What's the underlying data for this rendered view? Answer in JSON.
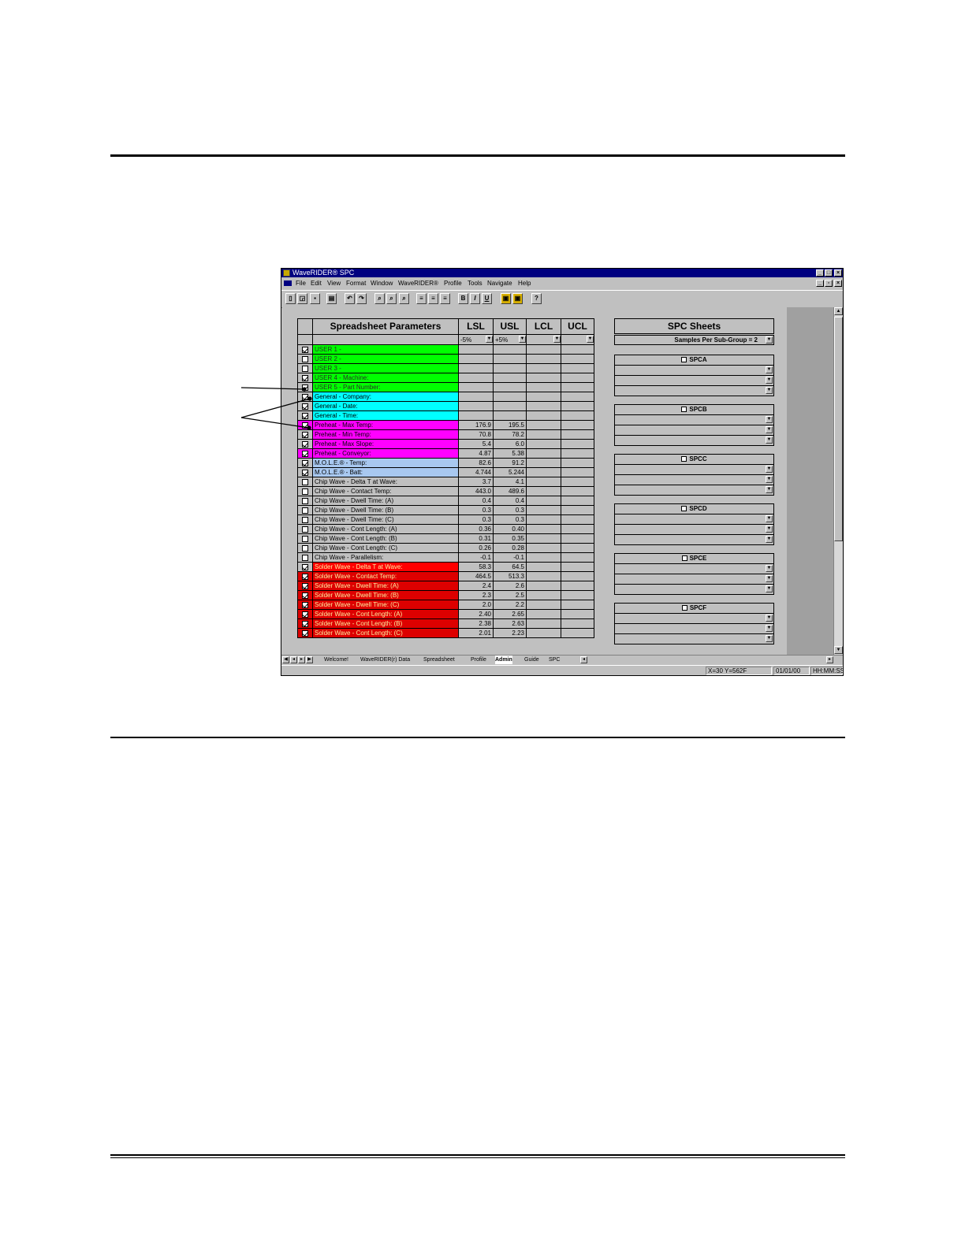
{
  "window": {
    "title": "WaveRIDER® SPC",
    "menu": [
      "File",
      "Edit",
      "View",
      "Format",
      "Window",
      "WaveRIDER®",
      "Profile",
      "Tools",
      "Navigate",
      "Help"
    ]
  },
  "sheet": {
    "header": {
      "params": "Spreadsheet Parameters",
      "lsl": "LSL",
      "usl": "USL",
      "lcl": "LCL",
      "ucl": "UCL"
    },
    "subheader": {
      "lsl": "-5%",
      "usl": "+5%"
    },
    "colors": {
      "green": "#00ff00",
      "cyan": "#00ffff",
      "magenta": "#ff00ff",
      "lightblue": "#a8c8f0",
      "gray": "#c0c0c0",
      "red": "#ff0000",
      "darkred": "#dd0000"
    },
    "rows": [
      {
        "label": "USER 1 -",
        "checked": true,
        "color": "#00ff00",
        "lsl": "",
        "usl": ""
      },
      {
        "label": "USER 2 -",
        "checked": false,
        "color": "#00ff00",
        "lsl": "",
        "usl": ""
      },
      {
        "label": "USER 3 -",
        "checked": false,
        "color": "#00ff00",
        "lsl": "",
        "usl": ""
      },
      {
        "label": "USER 4 - Machine:",
        "checked": true,
        "color": "#00ff00",
        "lsl": "",
        "usl": ""
      },
      {
        "label": "USER 5 - Part Number:",
        "checked": true,
        "color": "#00ff00",
        "lsl": "",
        "usl": ""
      },
      {
        "label": "General - Company:",
        "checked": true,
        "color": "#00ffff",
        "lsl": "",
        "usl": ""
      },
      {
        "label": "General - Date:",
        "checked": true,
        "color": "#00ffff",
        "lsl": "",
        "usl": ""
      },
      {
        "label": "General - Time:",
        "checked": true,
        "color": "#00ffff",
        "lsl": "",
        "usl": ""
      },
      {
        "label": "Preheat - Max Temp:",
        "checked": true,
        "color": "#ff00ff",
        "lsl": "176.9",
        "usl": "195.5"
      },
      {
        "label": "Preheat - Min Temp:",
        "checked": true,
        "color": "#ff00ff",
        "lsl": "70.8",
        "usl": "78.2"
      },
      {
        "label": "Preheat - Max Slope:",
        "checked": true,
        "color": "#ff00ff",
        "lsl": "5.4",
        "usl": "6.0"
      },
      {
        "label": "Preheat - Conveyor:",
        "checked": true,
        "color": "#ff00ff",
        "lsl": "4.87",
        "usl": "5.38"
      },
      {
        "label": "M.O.L.E.® - Temp:",
        "checked": true,
        "color": "#a8c8f0",
        "lsl": "82.6",
        "usl": "91.2"
      },
      {
        "label": "M.O.L.E.® - Batt:",
        "checked": true,
        "color": "#a8c8f0",
        "lsl": "4.744",
        "usl": "5.244"
      },
      {
        "label": "Chip Wave - Delta T at Wave:",
        "checked": false,
        "color": "#c0c0c0",
        "lsl": "3.7",
        "usl": "4.1"
      },
      {
        "label": "Chip Wave - Contact Temp:",
        "checked": false,
        "color": "#c0c0c0",
        "lsl": "443.0",
        "usl": "489.6"
      },
      {
        "label": "Chip Wave - Dwell Time: (A)",
        "checked": false,
        "color": "#c0c0c0",
        "lsl": "0.4",
        "usl": "0.4"
      },
      {
        "label": "Chip Wave - Dwell Time: (B)",
        "checked": false,
        "color": "#c0c0c0",
        "lsl": "0.3",
        "usl": "0.3"
      },
      {
        "label": "Chip Wave - Dwell Time: (C)",
        "checked": false,
        "color": "#c0c0c0",
        "lsl": "0.3",
        "usl": "0.3"
      },
      {
        "label": "Chip Wave - Cont Length: (A)",
        "checked": false,
        "color": "#c0c0c0",
        "lsl": "0.36",
        "usl": "0.40"
      },
      {
        "label": "Chip Wave - Cont Length: (B)",
        "checked": false,
        "color": "#c0c0c0",
        "lsl": "0.31",
        "usl": "0.35"
      },
      {
        "label": "Chip Wave - Cont Length: (C)",
        "checked": false,
        "color": "#c0c0c0",
        "lsl": "0.26",
        "usl": "0.28"
      },
      {
        "label": "Chip Wave - Parallelism:",
        "checked": false,
        "color": "#c0c0c0",
        "lsl": "-0.1",
        "usl": "-0.1"
      },
      {
        "label": "Solder Wave - Delta T at Wave:",
        "checked": true,
        "color": "#ff0000",
        "lsl": "58.3",
        "usl": "64.5"
      },
      {
        "label": "Solder Wave - Contact Temp:",
        "checked": true,
        "color": "#dd0000",
        "lsl": "464.5",
        "usl": "513.3"
      },
      {
        "label": "Solder Wave - Dwell Time: (A)",
        "checked": true,
        "color": "#dd0000",
        "lsl": "2.4",
        "usl": "2.6"
      },
      {
        "label": "Solder Wave - Dwell Time: (B)",
        "checked": true,
        "color": "#dd0000",
        "lsl": "2.3",
        "usl": "2.5"
      },
      {
        "label": "Solder Wave - Dwell Time: (C)",
        "checked": true,
        "color": "#dd0000",
        "lsl": "2.0",
        "usl": "2.2"
      },
      {
        "label": "Solder Wave - Cont Length: (A)",
        "checked": true,
        "color": "#dd0000",
        "lsl": "2.40",
        "usl": "2.65"
      },
      {
        "label": "Solder Wave - Cont Length: (B)",
        "checked": true,
        "color": "#dd0000",
        "lsl": "2.38",
        "usl": "2.63"
      },
      {
        "label": "Solder Wave - Cont Length: (C)",
        "checked": true,
        "color": "#dd0000",
        "lsl": "2.01",
        "usl": "2.23"
      }
    ]
  },
  "spc": {
    "title": "SPC Sheets",
    "samples": "Samples Per Sub-Group = 2",
    "sheets": [
      "SPCA",
      "SPCB",
      "SPCC",
      "SPCD",
      "SPCE",
      "SPCF"
    ]
  },
  "tabs": [
    "Welcome!",
    "WaveRIDER(r) Data",
    "Spreadsheet",
    "Profile",
    "Admin",
    "Guide",
    "SPC"
  ],
  "active_tab": "Admin",
  "status": {
    "coords": "X=30 Y=562F",
    "date": "01/01/00",
    "time": "HH:MM:SS"
  }
}
